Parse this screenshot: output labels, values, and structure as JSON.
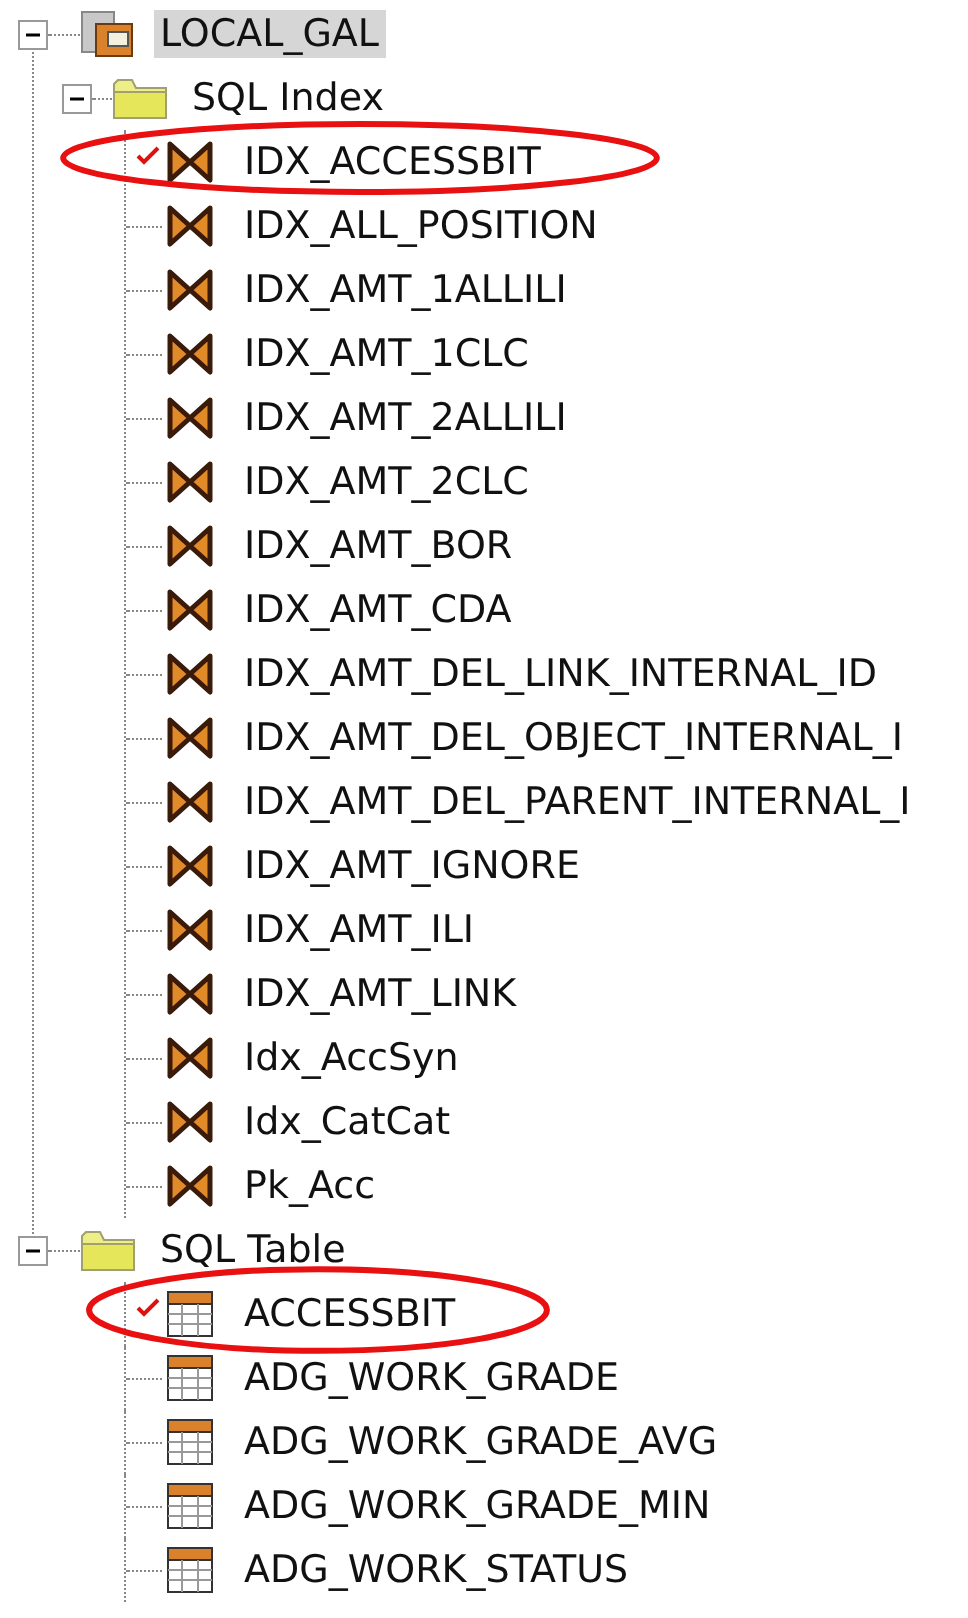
{
  "tree": [
    {
      "label": "LOCAL_GAL",
      "kind": "database",
      "expanded": true,
      "selected": true,
      "children": [
        {
          "label": "SQL Index",
          "kind": "folder",
          "expanded": true,
          "selected": false,
          "children": [
            {
              "label": "IDX_ACCESSBIT",
              "kind": "index",
              "selected": false,
              "checked": true,
              "circled": true
            },
            {
              "label": "IDX_ALL_POSITION",
              "kind": "index",
              "selected": false,
              "checked": false,
              "circled": false
            },
            {
              "label": "IDX_AMT_1ALLILI",
              "kind": "index",
              "selected": false,
              "checked": false,
              "circled": false
            },
            {
              "label": "IDX_AMT_1CLC",
              "kind": "index",
              "selected": false,
              "checked": false,
              "circled": false
            },
            {
              "label": "IDX_AMT_2ALLILI",
              "kind": "index",
              "selected": false,
              "checked": false,
              "circled": false
            },
            {
              "label": "IDX_AMT_2CLC",
              "kind": "index",
              "selected": false,
              "checked": false,
              "circled": false
            },
            {
              "label": "IDX_AMT_BOR",
              "kind": "index",
              "selected": false,
              "checked": false,
              "circled": false
            },
            {
              "label": "IDX_AMT_CDA",
              "kind": "index",
              "selected": false,
              "checked": false,
              "circled": false
            },
            {
              "label": "IDX_AMT_DEL_LINK_INTERNAL_ID",
              "kind": "index",
              "selected": false,
              "checked": false,
              "circled": false
            },
            {
              "label": "IDX_AMT_DEL_OBJECT_INTERNAL_I",
              "kind": "index",
              "selected": false,
              "checked": false,
              "circled": false
            },
            {
              "label": "IDX_AMT_DEL_PARENT_INTERNAL_I",
              "kind": "index",
              "selected": false,
              "checked": false,
              "circled": false
            },
            {
              "label": "IDX_AMT_IGNORE",
              "kind": "index",
              "selected": false,
              "checked": false,
              "circled": false
            },
            {
              "label": "IDX_AMT_ILI",
              "kind": "index",
              "selected": false,
              "checked": false,
              "circled": false
            },
            {
              "label": "IDX_AMT_LINK",
              "kind": "index",
              "selected": false,
              "checked": false,
              "circled": false
            },
            {
              "label": "Idx_AccSyn",
              "kind": "index",
              "selected": false,
              "checked": false,
              "circled": false
            },
            {
              "label": "Idx_CatCat",
              "kind": "index",
              "selected": false,
              "checked": false,
              "circled": false
            },
            {
              "label": "Pk_Acc",
              "kind": "index",
              "selected": false,
              "checked": false,
              "circled": false
            }
          ]
        }
      ]
    },
    {
      "label": "SQL Table",
      "kind": "folder",
      "expanded": true,
      "selected": false,
      "children": [
        {
          "label": "ACCESSBIT",
          "kind": "table",
          "selected": false,
          "checked": true,
          "circled": true
        },
        {
          "label": "ADG_WORK_GRADE",
          "kind": "table",
          "selected": false,
          "checked": false,
          "circled": false
        },
        {
          "label": "ADG_WORK_GRADE_AVG",
          "kind": "table",
          "selected": false,
          "checked": false,
          "circled": false
        },
        {
          "label": "ADG_WORK_GRADE_MIN",
          "kind": "table",
          "selected": false,
          "checked": false,
          "circled": false
        },
        {
          "label": "ADG_WORK_STATUS",
          "kind": "table",
          "selected": false,
          "checked": false,
          "circled": false
        }
      ]
    }
  ]
}
